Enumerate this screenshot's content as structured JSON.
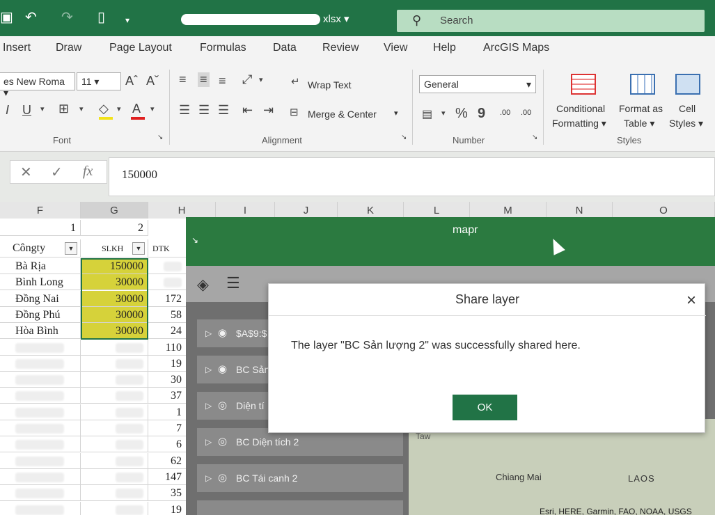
{
  "titlebar": {
    "filename_suffix": "xlsx",
    "search_placeholder": "Search"
  },
  "tabs": [
    "Insert",
    "Draw",
    "Page Layout",
    "Formulas",
    "Data",
    "Review",
    "View",
    "Help",
    "ArcGIS Maps"
  ],
  "ribbon": {
    "font_name": "es New Roma",
    "font_size": "11",
    "font_group_label": "Font",
    "wrap_text": "Wrap Text",
    "merge_center": "Merge & Center",
    "alignment_group_label": "Alignment",
    "number_format": "General",
    "number_group_label": "Number",
    "conditional_formatting_1": "Conditional",
    "conditional_formatting_2": "Formatting",
    "format_as_table_1": "Format as",
    "format_as_table_2": "Table",
    "cell_styles_1": "Cell",
    "cell_styles_2": "Styles",
    "styles_group_label": "Styles",
    "percent": "%",
    "comma": "9",
    "dec_inc": ".00",
    "dec_dec": ".00"
  },
  "formula_bar": {
    "fx": "fx",
    "value": "150000"
  },
  "columns": [
    "F",
    "G",
    "H",
    "I",
    "J",
    "K",
    "L",
    "M",
    "N",
    "O"
  ],
  "row1": {
    "f": "1",
    "g": "2"
  },
  "headers": {
    "f": "Côngty",
    "g": "SLKH",
    "h": "DTK"
  },
  "rows": [
    {
      "company": "Bà Rịa",
      "slkh": "150000",
      "h": ""
    },
    {
      "company": "Bình Long",
      "slkh": "30000",
      "h": ""
    },
    {
      "company": "Đồng Nai",
      "slkh": "30000",
      "h": "172"
    },
    {
      "company": "Đồng Phú",
      "slkh": "30000",
      "h": "58"
    },
    {
      "company": "Hòa Bình",
      "slkh": "30000",
      "h": "24"
    },
    {
      "company": "",
      "slkh": "",
      "h": "110"
    },
    {
      "company": "",
      "slkh": "",
      "h": "19"
    },
    {
      "company": "",
      "slkh": "",
      "h": "30"
    },
    {
      "company": "",
      "slkh": "",
      "h": "37"
    },
    {
      "company": "",
      "slkh": "",
      "h": "1"
    },
    {
      "company": "",
      "slkh": "",
      "h": "7"
    },
    {
      "company": "",
      "slkh": "",
      "h": "6"
    },
    {
      "company": "",
      "slkh": "",
      "h": "62"
    },
    {
      "company": "",
      "slkh": "",
      "h": "147"
    },
    {
      "company": "",
      "slkh": "",
      "h": "35"
    },
    {
      "company": "",
      "slkh": "",
      "h": "19"
    }
  ],
  "panel": {
    "title": "mapr",
    "layers": [
      "$A$9:$",
      "BC Sản",
      "Diện tí",
      "BC Diện tích 2",
      "BC Tái canh 2"
    ],
    "map_labels": [
      "Taw",
      "Chiang Mai",
      "LAOS"
    ],
    "attribution": "Esri, HERE, Garmin, FAO, NOAA, USGS"
  },
  "dialog": {
    "title": "Share layer",
    "message": "The layer \"BC Sản lượng 2\" was successfully shared here.",
    "ok_label": "OK",
    "close_glyph": "×"
  },
  "colors": {
    "excel_green": "#217346",
    "yellow_fill": "#d6d23a",
    "panel_header": "#2b7a40"
  }
}
